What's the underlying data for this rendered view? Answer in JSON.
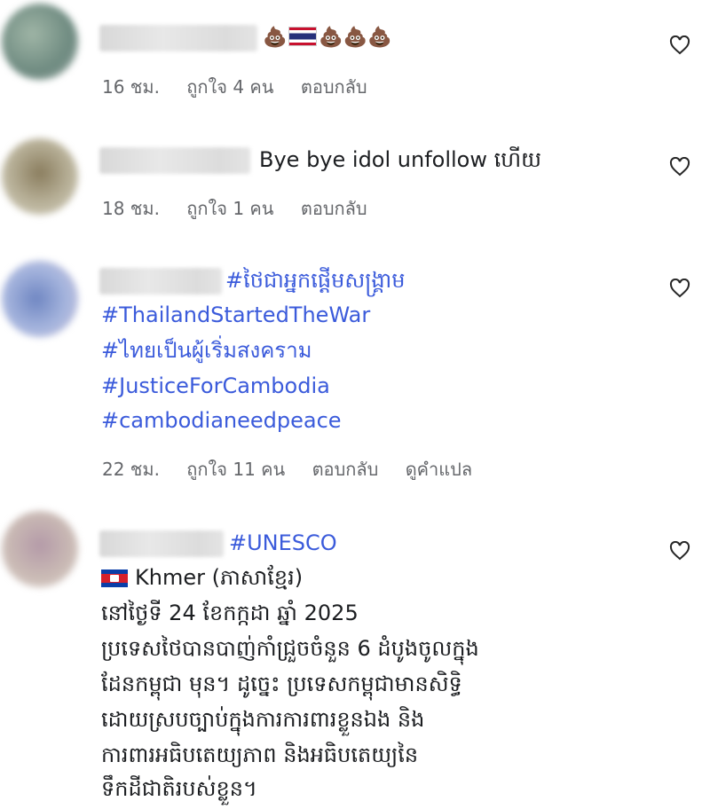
{
  "comments": [
    {
      "text_suffix": "",
      "emoji_row": [
        "💩",
        "💩",
        "💩",
        "💩"
      ],
      "meta": {
        "time": "16 ชม.",
        "likes": "ถูกใจ 4 คน",
        "reply": "ตอบกลับ"
      }
    },
    {
      "text": "Bye bye idol unfollow ហើយ",
      "meta": {
        "time": "18 ชม.",
        "likes": "ถูกใจ 1 คน",
        "reply": "ตอบกลับ"
      }
    },
    {
      "hashtags": [
        "#ថៃជាអ្នកផ្តើមសង្គ្រាម",
        "#ThailandStartedTheWar",
        "#ไทยเป็นผู้เริ่มสงคราม",
        "#JusticeForCambodia",
        "#cambodianeedpeace"
      ],
      "meta": {
        "time": "22 ชม.",
        "likes": "ถูกใจ 11 คน",
        "reply": "ตอบกลับ",
        "translate": "ดูคำแปล"
      }
    },
    {
      "hashtag": "#UNESCO",
      "lang_label": "Khmer (ភាសាខ្មែរ)",
      "body_lines": [
        "នៅថ្ងៃទី 24 ខែកក្កដា ឆ្នាំ 2025",
        "ប្រទេសថៃបានបាញ់កាំជ្រួចចំនួន 6 ដំបូងចូលក្នុង",
        "ដែនកម្ពុជា មុន។ ដូច្នេះ ប្រទេសកម្ពុជាមានសិទ្ធិ",
        "ដោយស្របច្បាប់ក្នុងការការពារខ្លួនឯង និង",
        "ការពារអធិបតេយ្យភាព និងអធិបតេយ្យនៃ",
        "ទឹកដីជាតិរបស់ខ្លួន។"
      ]
    }
  ],
  "icons": {
    "like": "heart-outline-icon",
    "flag_th": "thailand-flag-icon",
    "flag_kh": "cambodia-flag-icon"
  },
  "colors": {
    "hashtag": "#3b5bdb",
    "meta": "#65676b",
    "text": "#1c1e21"
  }
}
